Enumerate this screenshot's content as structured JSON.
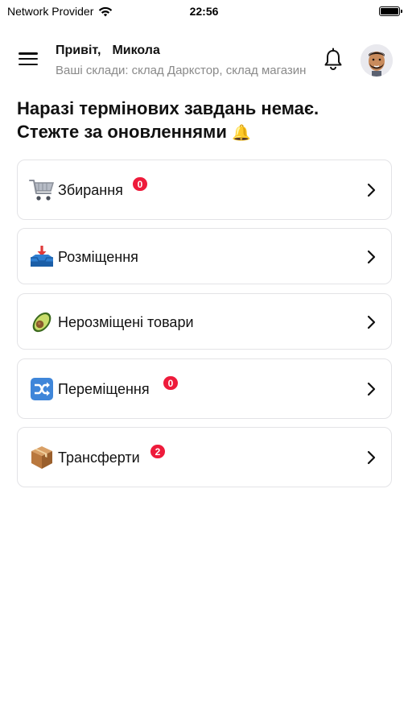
{
  "status_bar": {
    "carrier": "Network Provider",
    "time": "22:56"
  },
  "header": {
    "greeting": "Привіт,",
    "user_name": "Микола",
    "warehouses": "Ваші склади: склад Даркстор, склад магазин"
  },
  "notice": {
    "line1": "Наразі термінових завдань немає.",
    "line2": "Стежте за оновленнями",
    "emoji": "🔔"
  },
  "menu": {
    "items": [
      {
        "label": "Збирання",
        "icon": "shopping-cart-icon",
        "badge": "0"
      },
      {
        "label": "Розміщення",
        "icon": "inbox-tray-icon",
        "badge": null
      },
      {
        "label": "Нерозміщені товари",
        "icon": "avocado-icon",
        "badge": null
      },
      {
        "label": "Переміщення",
        "icon": "shuffle-icon",
        "badge": "0"
      },
      {
        "label": "Трансферти",
        "icon": "package-icon",
        "badge": "2"
      }
    ]
  },
  "colors": {
    "badge": "#ee1b3b",
    "card_border": "#e3e3e6",
    "subtitle": "#8a8a8a"
  }
}
